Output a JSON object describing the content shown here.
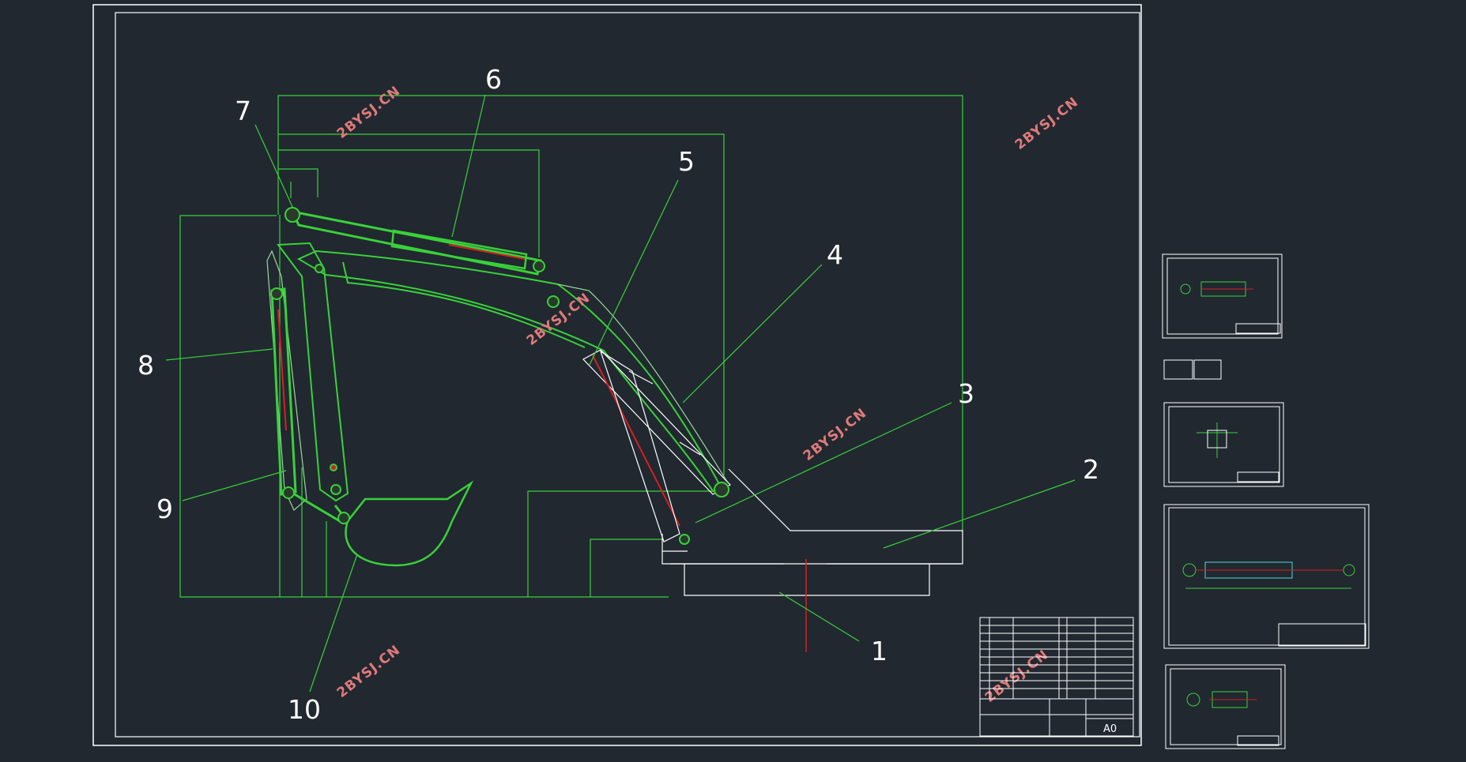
{
  "drawing": {
    "callouts": [
      "1",
      "2",
      "3",
      "4",
      "5",
      "6",
      "7",
      "8",
      "9",
      "10"
    ],
    "watermark": "2BYSJ.CN",
    "sheet_size": "A0",
    "colors": {
      "background": "#212830",
      "frame": "#ffffff",
      "green": "#39d13a",
      "red": "#d42020",
      "watermark": "#e07a7a"
    }
  }
}
